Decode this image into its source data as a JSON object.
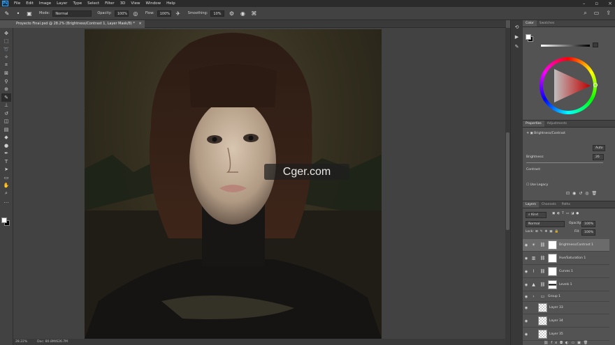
{
  "menubar": {
    "app_icon": "Ps",
    "items": [
      "File",
      "Edit",
      "Image",
      "Layer",
      "Type",
      "Select",
      "Filter",
      "3D",
      "View",
      "Window",
      "Help"
    ]
  },
  "options": {
    "mode_label": "Mode:",
    "mode_value": "Normal",
    "opacity_label": "Opacity:",
    "opacity_value": "100%",
    "flow_label": "Flow:",
    "flow_value": "100%",
    "smoothing_label": "Smoothing:",
    "smoothing_value": "10%"
  },
  "document": {
    "tab_title": "Proyecto Final.psd @ 28.2% (Brightness/Contrast 1, Layer Mask/8) *",
    "tab_close": "×"
  },
  "status": {
    "zoom": "28.22%",
    "doc": "Doc: 80.8M/626.7M"
  },
  "color_panel": {
    "tabs": [
      "Color",
      "Swatches"
    ],
    "fg": "#ffffff",
    "bg": "#000000"
  },
  "properties": {
    "tabs": [
      "Properties",
      "Adjustments"
    ],
    "title": "Brightness/Contrast",
    "auto": "Auto",
    "brightness_label": "Brightness:",
    "brightness_value": "26",
    "contrast_label": "Contrast:",
    "contrast_value": "0",
    "legacy_label": "Use Legacy"
  },
  "layers": {
    "tabs": [
      "Layers",
      "Channels",
      "Paths"
    ],
    "filter_kind": "Kind",
    "blend_mode": "Normal",
    "opacity_label": "Opacity:",
    "opacity_value": "100%",
    "lock_label": "Lock:",
    "fill_label": "Fill:",
    "fill_value": "100%",
    "rows": [
      {
        "name": "Brightness/Contrast 1",
        "type": "adjustment",
        "icon": "☀"
      },
      {
        "name": "Hue/Saturation 1",
        "type": "adjustment",
        "icon": "▥"
      },
      {
        "name": "Curves 1",
        "type": "adjustment",
        "icon": "⌇"
      },
      {
        "name": "Levels 1",
        "type": "adjustment",
        "icon": "▲"
      },
      {
        "name": "Group 1",
        "type": "group",
        "icon": "▭"
      },
      {
        "name": "Layer 33",
        "type": "pixel",
        "icon": ""
      },
      {
        "name": "Layer 34",
        "type": "pixel",
        "icon": ""
      },
      {
        "name": "Layer 35",
        "type": "pixel",
        "icon": ""
      }
    ]
  },
  "watermark": "Cger.com"
}
